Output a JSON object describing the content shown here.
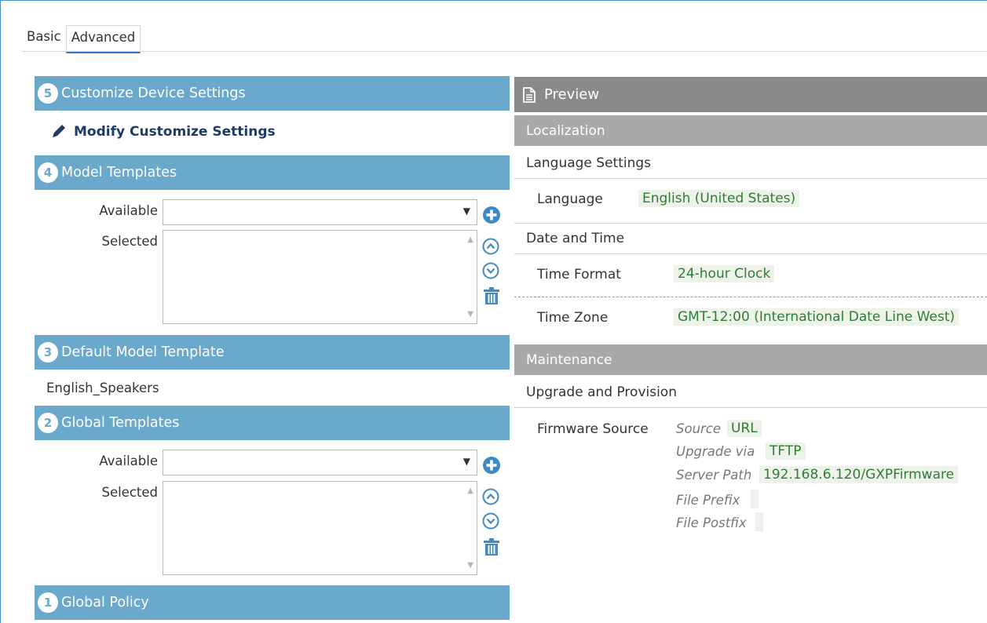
{
  "tabs": {
    "basic": "Basic",
    "advanced": "Advanced"
  },
  "left": {
    "section5": {
      "num": "5",
      "title": "Customize Device Settings"
    },
    "modify_label": "Modify Customize Settings",
    "section4": {
      "num": "4",
      "title": "Model Templates"
    },
    "model_templates": {
      "available_label": "Available",
      "selected_label": "Selected",
      "available_value": ""
    },
    "section3": {
      "num": "3",
      "title": "Default Model Template"
    },
    "default_model_template": "English_Speakers",
    "section2": {
      "num": "2",
      "title": "Global Templates"
    },
    "global_templates": {
      "available_label": "Available",
      "selected_label": "Selected",
      "available_value": ""
    },
    "section1": {
      "num": "1",
      "title": "Global Policy"
    }
  },
  "preview": {
    "title": "Preview",
    "localization": {
      "title": "Localization",
      "language_settings": {
        "title": "Language Settings",
        "language_label": "Language",
        "language_value": "English (United States)"
      },
      "date_time": {
        "title": "Date and Time",
        "time_format_label": "Time Format",
        "time_format_value": "24-hour Clock",
        "time_zone_label": "Time Zone",
        "time_zone_value": "GMT-12:00 (International Date Line West)"
      }
    },
    "maintenance": {
      "title": "Maintenance",
      "upgrade": {
        "title": "Upgrade and Provision",
        "firmware_source_label": "Firmware Source",
        "source_label": "Source",
        "source_value": "URL",
        "upgrade_via_label": "Upgrade via",
        "upgrade_via_value": "TFTP",
        "server_path_label": "Server Path",
        "server_path_value": "192.168.6.120/GXPFirmware",
        "file_prefix_label": "File Prefix",
        "file_postfix_label": "File Postfix"
      }
    }
  },
  "colors": {
    "section_blue": "#6aa8cc",
    "preview_dark": "#8a8a8a",
    "preview_section": "#a9a9a9",
    "value_green": "#2e7d32",
    "icon_blue": "#3f8ac2"
  }
}
